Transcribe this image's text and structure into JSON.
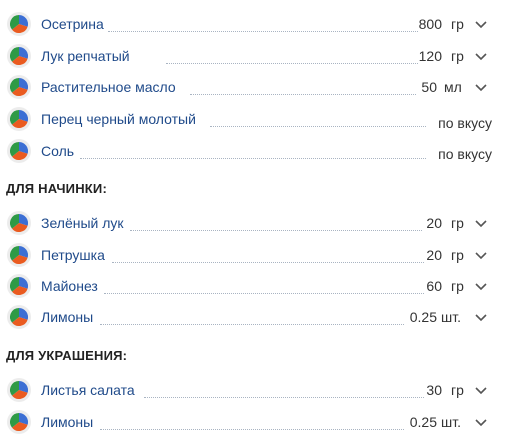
{
  "colors": {
    "pie_green": "#2e9a46",
    "pie_orange": "#ea5b20",
    "pie_blue": "#3c6fd4",
    "pie_bg": "#ececec",
    "link": "#1f4a8a"
  },
  "group_main": {
    "items": [
      {
        "name": "Осетрина",
        "qty": "800",
        "unit": "гр"
      },
      {
        "name": "Лук репчатый",
        "qty": "120",
        "unit": "гр"
      },
      {
        "name": "Растительное масло",
        "qty": "50",
        "unit": "мл"
      },
      {
        "name": "Перец черный молотый",
        "qty": "по вкусу",
        "unit": ""
      },
      {
        "name": "Соль",
        "qty": "по вкусу",
        "unit": ""
      }
    ]
  },
  "group_filling": {
    "title": "ДЛЯ НАЧИНКИ:",
    "items": [
      {
        "name": "Зелёный лук",
        "qty": "20",
        "unit": "гр"
      },
      {
        "name": "Петрушка",
        "qty": "20",
        "unit": "гр"
      },
      {
        "name": "Майонез",
        "qty": "60",
        "unit": "гр"
      },
      {
        "name": "Лимоны",
        "qty": "0.25",
        "unit": "шт."
      }
    ]
  },
  "group_decor": {
    "title": "ДЛЯ УКРАШЕНИЯ:",
    "items": [
      {
        "name": "Листья салата",
        "qty": "30",
        "unit": "гр"
      },
      {
        "name": "Лимоны",
        "qty": "0.25",
        "unit": "шт."
      }
    ]
  }
}
